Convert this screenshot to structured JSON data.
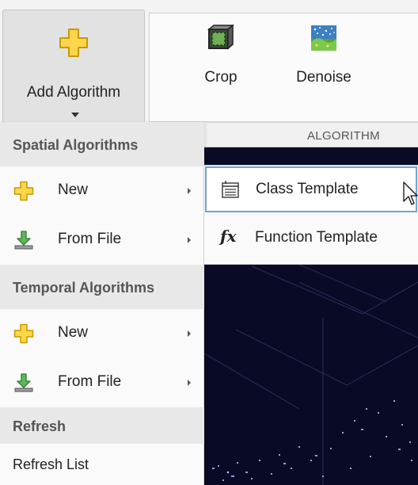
{
  "ribbon": {
    "add_algorithm_label": "Add Algorithm",
    "tools": [
      {
        "label": "Crop",
        "icon": "crop-icon"
      },
      {
        "label": "Denoise",
        "icon": "denoise-icon"
      }
    ],
    "group_label": "ALGORITHM"
  },
  "menu": {
    "spatial_header": "Spatial Algorithms",
    "spatial_new": "New",
    "spatial_from_file": "From File",
    "temporal_header": "Temporal Algorithms",
    "temporal_new": "New",
    "temporal_from_file": "From File",
    "refresh_header": "Refresh",
    "refresh_list": "Refresh List"
  },
  "submenu": {
    "class_template": "Class Template",
    "function_template": "Function Template",
    "function_icon_text": "fx"
  },
  "colors": {
    "accent_hover_border": "#6ea5d8",
    "viewer_background": "#090a26",
    "plus_icon_fill": "#ffd54a"
  }
}
